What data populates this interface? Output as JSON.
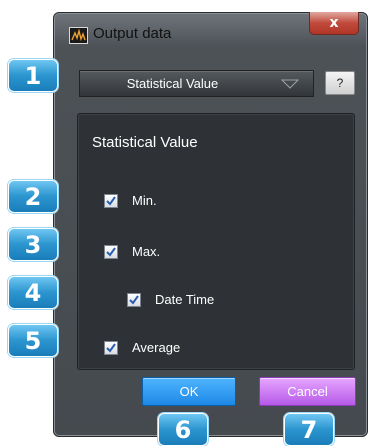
{
  "window": {
    "title": "Output data",
    "close_label": "x"
  },
  "dropdown": {
    "selected": "Statistical Value"
  },
  "help": {
    "label": "?"
  },
  "panel": {
    "title": "Statistical Value",
    "options": [
      {
        "label": "Min.",
        "checked": true
      },
      {
        "label": "Max.",
        "checked": true
      },
      {
        "label": "Date Time",
        "checked": true
      },
      {
        "label": "Average",
        "checked": true
      }
    ]
  },
  "buttons": {
    "ok": "OK",
    "cancel": "Cancel"
  },
  "callouts": [
    "1",
    "2",
    "3",
    "4",
    "5",
    "6",
    "7"
  ],
  "colors": {
    "ok": "#2a93ec",
    "cancel": "#c878f0",
    "badge": "#2b95cf",
    "panel": "#2e3236"
  }
}
